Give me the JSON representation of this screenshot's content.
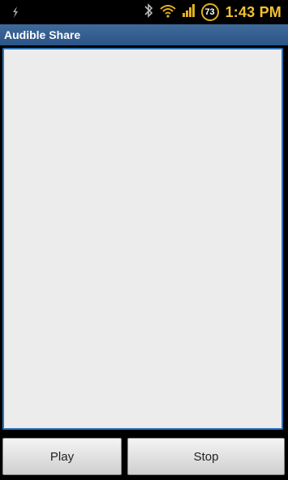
{
  "status_bar": {
    "left_icon": "usb-debug-icon",
    "icons": [
      "bluetooth-icon",
      "wifi-icon",
      "signal-icon"
    ],
    "battery_level": "73",
    "time": "1:43 PM",
    "clock_color": "#f2c230"
  },
  "app": {
    "title": "Audible Share",
    "title_bar_color": "#2c5487"
  },
  "text_area": {
    "value": "",
    "border_color": "#2e73b8"
  },
  "buttons": {
    "play_label": "Play",
    "stop_label": "Stop"
  }
}
